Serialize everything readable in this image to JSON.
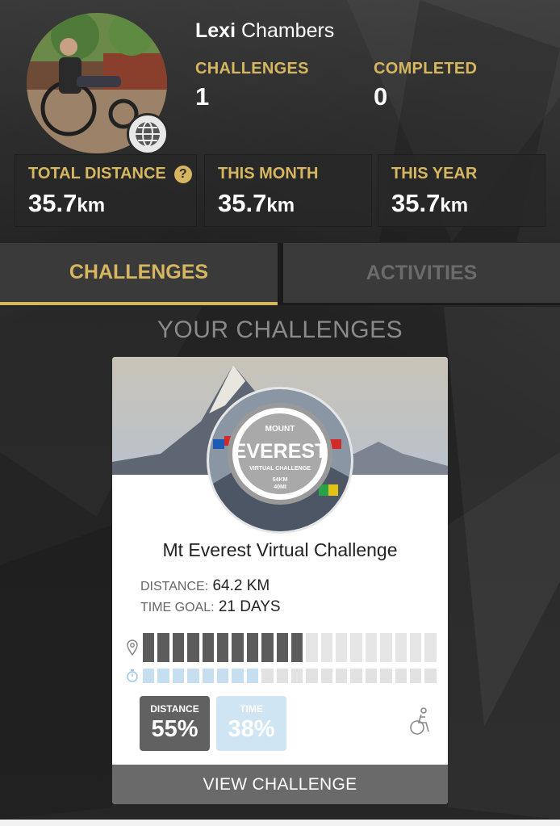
{
  "profile": {
    "first_name": "Lexi",
    "last_name": "Chambers",
    "avatar_icon": "avatar-photo",
    "badge_icon": "globe-people-icon",
    "challenges_label": "CHALLENGES",
    "challenges_value": "1",
    "completed_label": "COMPLETED",
    "completed_value": "0"
  },
  "distance": {
    "total_label": "TOTAL DISTANCE",
    "total_value": "35.7",
    "month_label": "THIS MONTH",
    "month_value": "35.7",
    "year_label": "THIS YEAR",
    "year_value": "35.7",
    "unit": "km",
    "help_icon": "?"
  },
  "tabs": {
    "challenges": "CHALLENGES",
    "activities": "ACTIVITIES",
    "active": "challenges"
  },
  "section_title": "YOUR CHALLENGES",
  "challenge": {
    "title": "Mt Everest Virtual Challenge",
    "badge": {
      "top": "MOUNT",
      "name": "EVEREST",
      "sub": "VIRTUAL CHALLENGE",
      "km": "64KM",
      "mi": "40MI"
    },
    "distance_label": "DISTANCE:",
    "distance_value": "64.2 KM",
    "time_goal_label": "TIME GOAL:",
    "time_goal_value": "21 DAYS",
    "progress": {
      "segments": 20,
      "distance_filled": 11,
      "time_filled": 8
    },
    "distance_pill_label": "DISTANCE",
    "distance_pct": "55%",
    "time_pill_label": "TIME",
    "time_pct": "38%",
    "button_label": "VIEW CHALLENGE"
  },
  "colors": {
    "accent_gold": "#d6b75f",
    "distance_fill": "#5c5c5c",
    "time_fill": "#c6dff0"
  }
}
